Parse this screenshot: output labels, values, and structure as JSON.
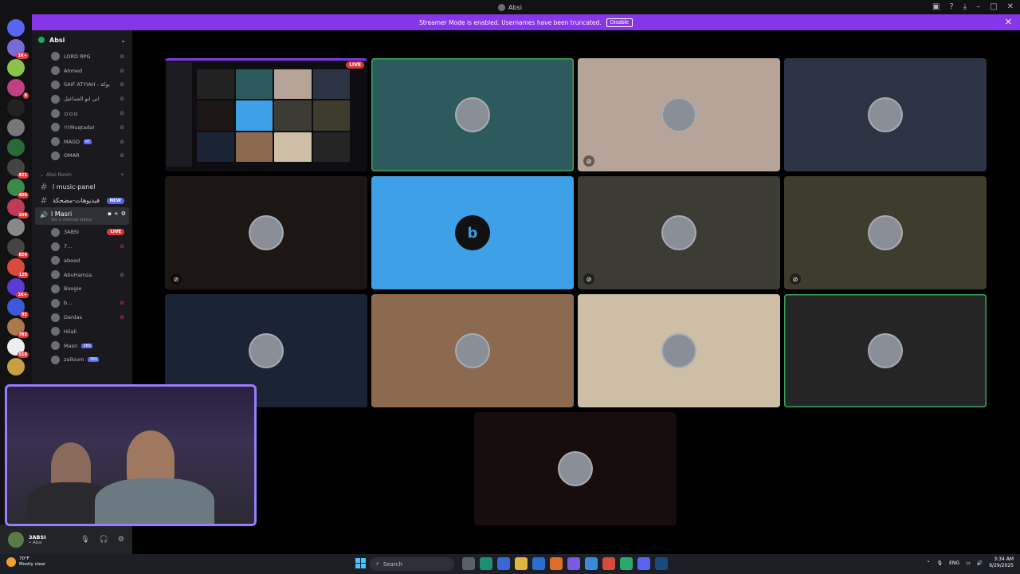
{
  "window": {
    "title": "Absi"
  },
  "banner": {
    "text": "Streamer Mode is enabled. Usernames have been truncated.",
    "button": "Disable"
  },
  "guilds": [
    {
      "badge": ""
    },
    {
      "badge": "1K+"
    },
    {
      "badge": ""
    },
    {
      "badge": "8"
    },
    {
      "badge": ""
    },
    {
      "badge": ""
    },
    {
      "badge": ""
    },
    {
      "badge": "921"
    },
    {
      "badge": "486"
    },
    {
      "badge": "394"
    },
    {
      "badge": ""
    },
    {
      "badge": "824"
    },
    {
      "badge": "129"
    },
    {
      "badge": "1K+"
    },
    {
      "badge": "92"
    },
    {
      "badge": "783"
    },
    {
      "badge": "518"
    },
    {
      "badge": ""
    }
  ],
  "server": {
    "name": "Absi"
  },
  "members_top": [
    {
      "name": "LORD RPG",
      "tag": "",
      "right": "muted"
    },
    {
      "name": "Ahmed",
      "tag": "",
      "right": "muted"
    },
    {
      "name": "SAIF ATYIAH - بوكة",
      "tag": "",
      "right": "muted"
    },
    {
      "name": "اني ابو الجماعيل",
      "tag": "",
      "right": "muted"
    },
    {
      "name": "ㅁㅁㅁ",
      "tag": "",
      "right": "muted"
    },
    {
      "name": "!!!Muqtada!",
      "tag": "",
      "right": "muted"
    },
    {
      "name": "MAGD",
      "tag": "RT",
      "right": "muted"
    },
    {
      "name": "OMAR",
      "tag": "",
      "right": "muted"
    }
  ],
  "category": {
    "name": "Absi Room"
  },
  "channels": [
    {
      "name": "l music-panel",
      "badge": ""
    },
    {
      "name": "فيديوهات-مضحكة",
      "badge": "NEW"
    }
  ],
  "voice_channel": {
    "name": "l Masri",
    "status": "Set a channel status"
  },
  "voice_members": [
    {
      "name": "3ABSI",
      "tag": "",
      "right": "LIVE"
    },
    {
      "name": "7...",
      "tag": "",
      "right": "red"
    },
    {
      "name": "abood",
      "tag": "",
      "right": ""
    },
    {
      "name": "AbuHamza",
      "tag": "",
      "right": "muted"
    },
    {
      "name": "Boogie",
      "tag": "",
      "right": ""
    },
    {
      "name": "b...",
      "tag": "",
      "right": "red"
    },
    {
      "name": "Dardas",
      "tag": "",
      "right": "red"
    },
    {
      "name": "Hilali",
      "tag": "",
      "right": ""
    },
    {
      "name": "Masri",
      "tag": "3BS",
      "right": ""
    },
    {
      "name": "zalloum",
      "tag": "3BS",
      "right": ""
    }
  ],
  "user_panel": {
    "name": "3ABSI",
    "status": "• Absi"
  },
  "stream_tile": {
    "live_label": "LIVE"
  },
  "tiles": [
    {
      "color": "#2d5a5c",
      "speaking": true,
      "mute": false,
      "brand": ""
    },
    {
      "color": "#b5a497",
      "speaking": false,
      "mute": true,
      "brand": ""
    },
    {
      "color": "#2c3444",
      "speaking": false,
      "mute": false,
      "brand": ""
    },
    {
      "color": "#1c1715",
      "speaking": false,
      "mute": true,
      "brand": ""
    },
    {
      "color": "#3ea0e6",
      "speaking": false,
      "mute": false,
      "brand": "b"
    },
    {
      "color": "#3d3c34",
      "speaking": false,
      "mute": true,
      "brand": ""
    },
    {
      "color": "#3e3c2c",
      "speaking": false,
      "mute": true,
      "brand": ""
    },
    {
      "color": "#1b2434",
      "speaking": false,
      "mute": false,
      "brand": ""
    },
    {
      "color": "#8b6a50",
      "speaking": false,
      "mute": false,
      "brand": ""
    },
    {
      "color": "#cdbfa5",
      "speaking": false,
      "mute": false,
      "brand": ""
    },
    {
      "color": "#252525",
      "speaking": true,
      "mute": false,
      "brand": ""
    },
    {
      "color": "#170d0c",
      "speaking": false,
      "mute": false,
      "brand": ""
    }
  ],
  "taskbar": {
    "weather_temp": "70°F",
    "weather_desc": "Mostly clear",
    "search": "Search",
    "lang": "ENG",
    "time": "3:34 AM",
    "date": "6/29/2025"
  },
  "colors": {
    "accent": "#8636e8",
    "live": "#da373c",
    "speaking": "#3ba55c"
  }
}
